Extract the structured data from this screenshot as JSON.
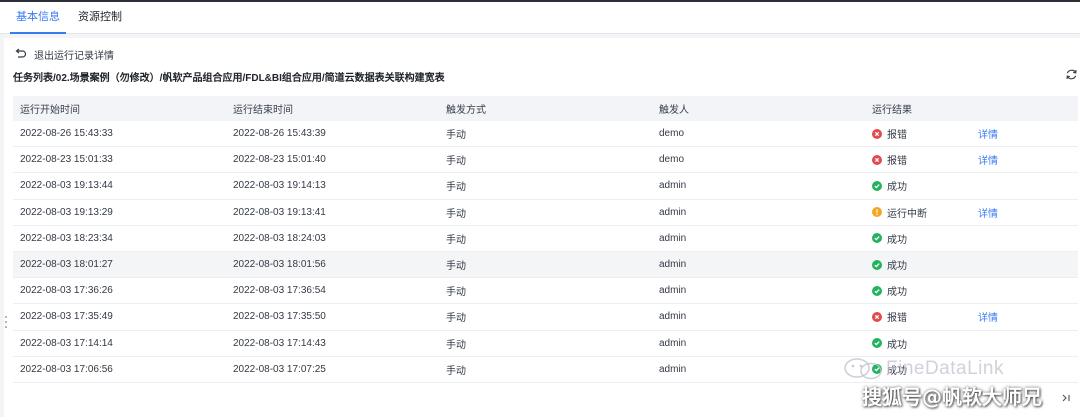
{
  "tabs": [
    {
      "label": "基本信息",
      "active": true
    },
    {
      "label": "资源控制",
      "active": false
    }
  ],
  "back": {
    "label": "退出运行记录详情",
    "icon": "undo-arrow-icon"
  },
  "breadcrumb": "任务列表/02.场景案例（勿修改）/帆软产品组合应用/FDL&BI组合应用/简道云数据表关联构建宽表",
  "refresh_icon": "refresh-icon",
  "columns": [
    "运行开始时间",
    "运行结束时间",
    "触发方式",
    "触发人",
    "运行结果"
  ],
  "rows": [
    {
      "start": "2022-08-26 15:43:33",
      "end": "2022-08-26 15:43:39",
      "trigger": "手动",
      "user": "demo",
      "status": "error",
      "result": "报错",
      "detail": "详情"
    },
    {
      "start": "2022-08-23 15:01:33",
      "end": "2022-08-23 15:01:40",
      "trigger": "手动",
      "user": "demo",
      "status": "error",
      "result": "报错",
      "detail": "详情"
    },
    {
      "start": "2022-08-03 19:13:44",
      "end": "2022-08-03 19:14:13",
      "trigger": "手动",
      "user": "admin",
      "status": "success",
      "result": "成功",
      "detail": ""
    },
    {
      "start": "2022-08-03 19:13:29",
      "end": "2022-08-03 19:13:41",
      "trigger": "手动",
      "user": "admin",
      "status": "warning",
      "result": "运行中断",
      "detail": "详情"
    },
    {
      "start": "2022-08-03 18:23:34",
      "end": "2022-08-03 18:24:03",
      "trigger": "手动",
      "user": "admin",
      "status": "success",
      "result": "成功",
      "detail": ""
    },
    {
      "start": "2022-08-03 18:01:27",
      "end": "2022-08-03 18:01:56",
      "trigger": "手动",
      "user": "admin",
      "status": "success",
      "result": "成功",
      "detail": ""
    },
    {
      "start": "2022-08-03 17:36:26",
      "end": "2022-08-03 17:36:54",
      "trigger": "手动",
      "user": "admin",
      "status": "success",
      "result": "成功",
      "detail": ""
    },
    {
      "start": "2022-08-03 17:35:49",
      "end": "2022-08-03 17:35:50",
      "trigger": "手动",
      "user": "admin",
      "status": "error",
      "result": "报错",
      "detail": "详情"
    },
    {
      "start": "2022-08-03 17:14:14",
      "end": "2022-08-03 17:14:43",
      "trigger": "手动",
      "user": "admin",
      "status": "success",
      "result": "成功",
      "detail": ""
    },
    {
      "start": "2022-08-03 17:06:56",
      "end": "2022-08-03 17:07:25",
      "trigger": "手动",
      "user": "admin",
      "status": "success",
      "result": "成功",
      "detail": ""
    }
  ],
  "status_colors": {
    "error": "#e5484d",
    "success": "#22b35e",
    "warning": "#f5a623"
  },
  "accent_color": "#3a7af3",
  "watermark": {
    "brand": "FineDataLink",
    "source": "搜狐号@帆软大师兄",
    "logo_icon": "wechat-logo-icon"
  },
  "pager_icon": "page-next-icon"
}
